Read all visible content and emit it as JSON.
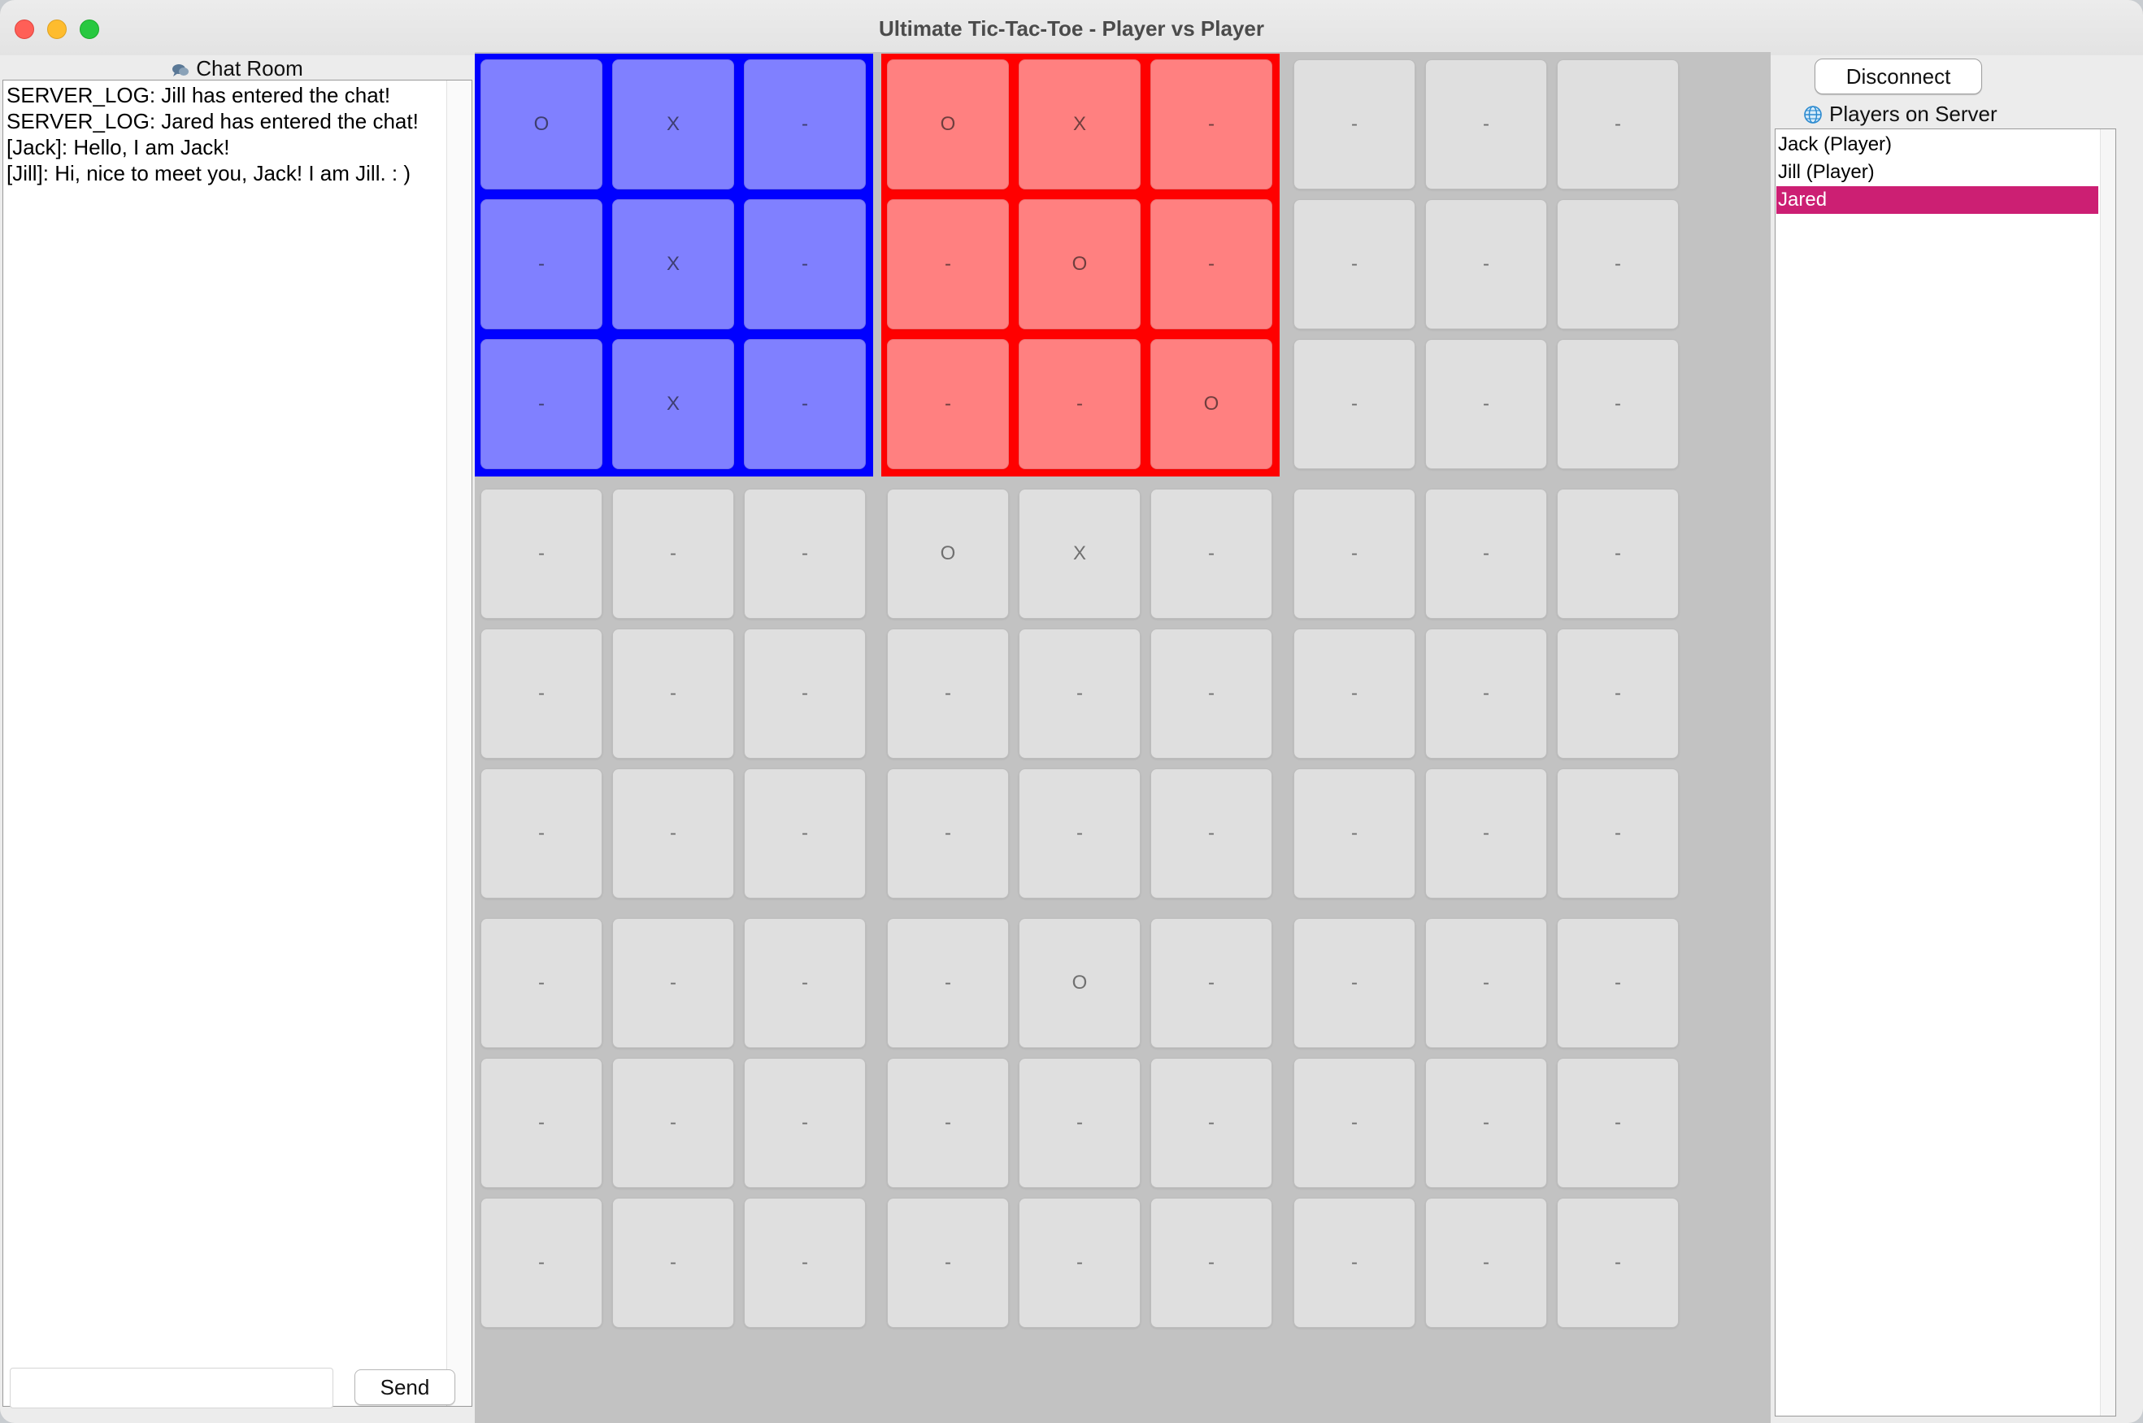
{
  "window": {
    "title": "Ultimate Tic-Tac-Toe - Player vs Player"
  },
  "chat": {
    "header": "Chat Room",
    "header_icon": "chat-bubbles-icon",
    "messages": [
      "SERVER_LOG: Jill has entered the chat!",
      "SERVER_LOG: Jared has entered the chat!",
      "[Jack]: Hello, I am Jack!",
      "[Jill]: Hi, nice to meet you, Jack! I am Jill. : )"
    ],
    "input_value": "",
    "send_label": "Send"
  },
  "players": {
    "disconnect_label": "Disconnect",
    "header": "Players on Server",
    "header_icon": "globe-icon",
    "list": [
      {
        "name": "Jack (Player)",
        "selected": false
      },
      {
        "name": "Jill (Player)",
        "selected": false
      },
      {
        "name": "Jared",
        "selected": true
      }
    ]
  },
  "colors": {
    "blue_board_border": "#0000ff",
    "blue_cell": "#8080ff",
    "red_board_border": "#ff0000",
    "red_cell": "#ff8080",
    "empty_cell": "#dfdfdf",
    "selected_player": "#cc1f73"
  },
  "board": {
    "highlighted_boards": [
      {
        "board": 0,
        "color": "blue"
      },
      {
        "board": 1,
        "color": "red"
      }
    ],
    "rows": [
      [
        "O",
        "X",
        "-",
        "O",
        "X",
        "-",
        "-",
        "-",
        "-"
      ],
      [
        "-",
        "X",
        "-",
        "-",
        "O",
        "-",
        "-",
        "-",
        "-"
      ],
      [
        "-",
        "X",
        "-",
        "-",
        "-",
        "O",
        "-",
        "-",
        "-"
      ],
      [
        "-",
        "-",
        "-",
        "O",
        "X",
        "-",
        "-",
        "-",
        "-"
      ],
      [
        "-",
        "-",
        "-",
        "-",
        "-",
        "-",
        "-",
        "-",
        "-"
      ],
      [
        "-",
        "-",
        "-",
        "-",
        "-",
        "-",
        "-",
        "-",
        "-"
      ],
      [
        "-",
        "-",
        "-",
        "-",
        "O",
        "-",
        "-",
        "-",
        "-"
      ],
      [
        "-",
        "-",
        "-",
        "-",
        "-",
        "-",
        "-",
        "-",
        "-"
      ],
      [
        "-",
        "-",
        "-",
        "-",
        "-",
        "-",
        "-",
        "-",
        "-"
      ]
    ]
  }
}
